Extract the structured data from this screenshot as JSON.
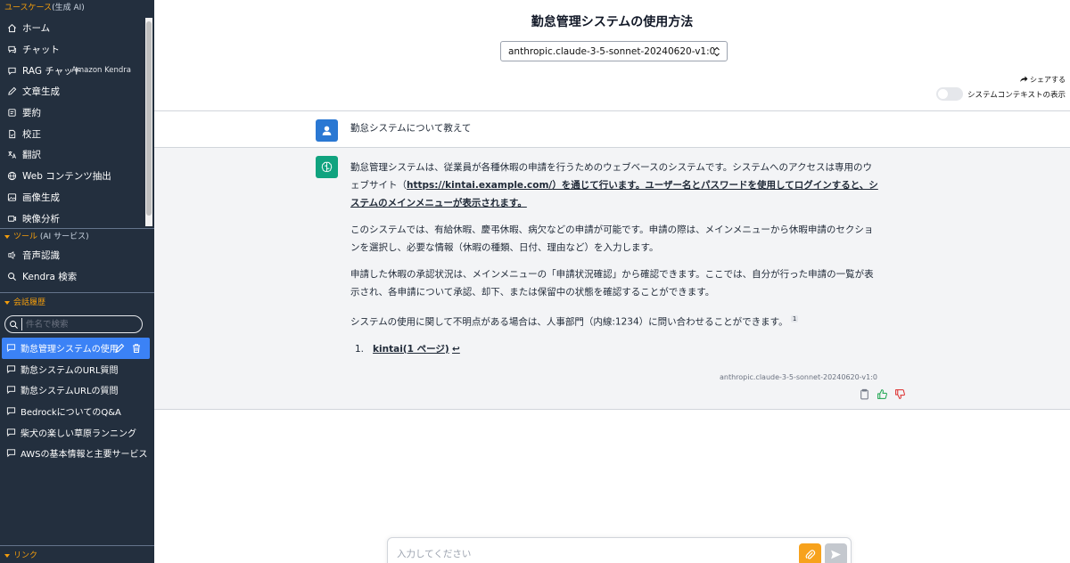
{
  "sidebar": {
    "usecase_head": "ユースケース",
    "usecase_sub": "(生成 AI)",
    "usecases": [
      {
        "label": "ホーム",
        "icon": "home-icon"
      },
      {
        "label": "チャット",
        "icon": "chat-icon"
      },
      {
        "label": "RAG チャット",
        "icon": "rag-chat-icon",
        "right": "Amazon Kendra"
      },
      {
        "label": "文章生成",
        "icon": "pencil-icon"
      },
      {
        "label": "要約",
        "icon": "summary-icon"
      },
      {
        "label": "校正",
        "icon": "proofread-icon"
      },
      {
        "label": "翻訳",
        "icon": "translate-icon"
      },
      {
        "label": "Web コンテンツ抽出",
        "icon": "globe-icon"
      },
      {
        "label": "画像生成",
        "icon": "image-icon"
      },
      {
        "label": "映像分析",
        "icon": "video-icon"
      }
    ],
    "tools_head": "ツール",
    "tools_sub": "(AI サービス)",
    "tools": [
      {
        "label": "音声認識",
        "icon": "microphone-icon"
      },
      {
        "label": "Kendra 検索",
        "icon": "search-icon"
      }
    ],
    "history_head": "会話履歴",
    "search_placeholder": "件名で検索",
    "history": [
      {
        "label": "勤怠管理システムの使用"
      },
      {
        "label": "勤怠システムのURL質問"
      },
      {
        "label": "勤怠システムURLの質問"
      },
      {
        "label": "BedrockについてのQ&A"
      },
      {
        "label": "柴犬の楽しい草原ランニング"
      },
      {
        "label": "AWSの基本情報と主要サービス"
      }
    ],
    "link_head": "リンク"
  },
  "main": {
    "title": "勤怠管理システムの使用方法",
    "model": "anthropic.claude-3-5-sonnet-20240620-v1:0",
    "share_label": "シェアする",
    "context_label": "システムコンテキストの表示",
    "user_message": "勤怠システムについて教えて",
    "bot": {
      "p1_a": "勤怠管理システムは、従業員が各種休暇の申請を行うためのウェブベースのシステムです。システムへのアクセスは専用のウェブサイト（",
      "p1_url": "https://kintai.example.com/",
      "p1_b": "）を通じて行います。ユーザー名とパスワードを使用してログインすると、システムのメインメニューが表示されます。",
      "p2": "このシステムでは、有給休暇、慶弔休暇、病欠などの申請が可能です。申請の際は、メインメニューから休暇申請のセクションを選択し、必要な情報（休暇の種類、日付、理由など）を入力します。",
      "p3": "申請した休暇の承認状況は、メインメニューの「申請状況確認」から確認できます。ここでは、自分が行った申請の一覧が表示され、各申請について承認、却下、または保留中の状態を確認することができます。",
      "p4": "システムの使用に関して不明点がある場合は、人事部門（内線:1234）に問い合わせることができます。",
      "footnote": "1",
      "ref_num": "1.",
      "ref_label": "kintai(1 ページ)",
      "ref_back": "↩",
      "model": "anthropic.claude-3-5-sonnet-20240620-v1:0"
    },
    "input_placeholder": "入力してください"
  },
  "colors": {
    "sidebar_bg": "#232f3e",
    "accent": "#f59e0b",
    "active_item": "#3b82f6",
    "user_avatar": "#2a78d3",
    "bot_avatar": "#10a37f",
    "attach_button": "#f7a21c",
    "thumb_up": "#16a34a",
    "thumb_down": "#dc2626"
  }
}
